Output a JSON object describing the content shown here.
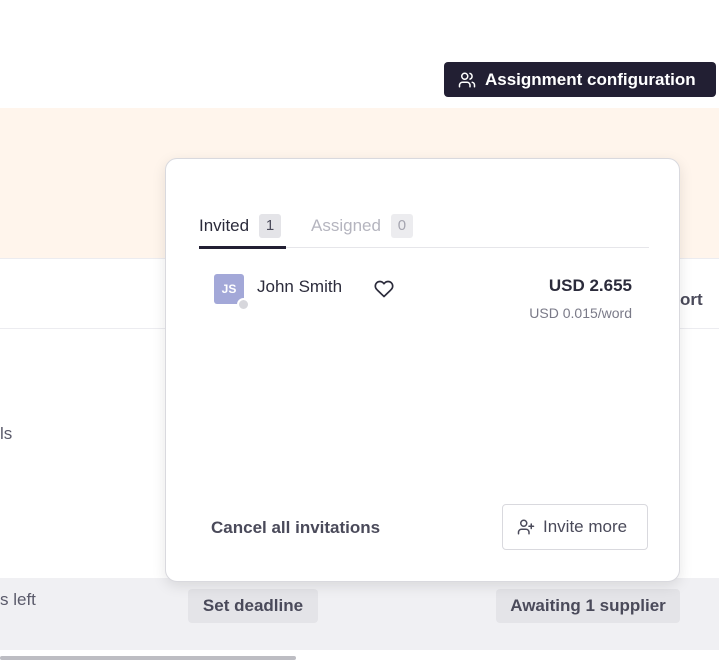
{
  "header": {
    "config_button_label": "Assignment configuration",
    "config_button_icon": "users-icon"
  },
  "background": {
    "left_fragment_1": "ls",
    "left_fragment_2": "s left",
    "right_fragment": "ort",
    "set_deadline_label": "Set deadline",
    "awaiting_label": "Awaiting 1 supplier"
  },
  "popover": {
    "tabs": [
      {
        "label": "Invited",
        "count": "1",
        "active": true
      },
      {
        "label": "Assigned",
        "count": "0",
        "active": false
      }
    ],
    "supplier": {
      "initials": "JS",
      "name": "John Smith",
      "favorite_icon": "heart-icon",
      "price": "USD 2.655",
      "rate": "USD 0.015/word"
    },
    "cancel_label": "Cancel all invitations",
    "invite_label": "Invite more",
    "invite_icon": "user-plus-icon"
  },
  "colors": {
    "primary_dark": "#221f33",
    "peach_band": "#fff5ec",
    "avatar_bg": "#a3a8d8"
  }
}
